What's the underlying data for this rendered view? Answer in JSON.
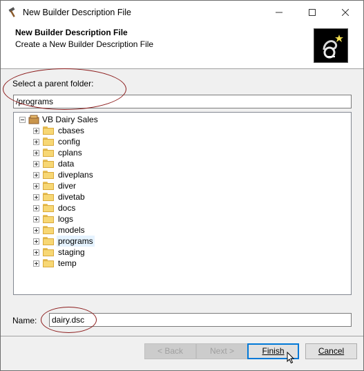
{
  "window": {
    "title": "New Builder Description File",
    "controls": {
      "minimize": "—",
      "maximize": "☐",
      "close": "✕"
    }
  },
  "banner": {
    "title": "New Builder Description File",
    "subtitle": "Create a New Builder Description File"
  },
  "parent_folder": {
    "label": "Select a parent folder:",
    "value": "/programs"
  },
  "tree": {
    "root": "VB Dairy Sales",
    "items": [
      {
        "label": "cbases"
      },
      {
        "label": "config"
      },
      {
        "label": "cplans"
      },
      {
        "label": "data"
      },
      {
        "label": "diveplans"
      },
      {
        "label": "diver"
      },
      {
        "label": "divetab"
      },
      {
        "label": "docs"
      },
      {
        "label": "logs"
      },
      {
        "label": "models"
      },
      {
        "label": "programs",
        "selected": true
      },
      {
        "label": "staging"
      },
      {
        "label": "temp"
      }
    ]
  },
  "name_field": {
    "label": "Name:",
    "value": "dairy.dsc"
  },
  "buttons": {
    "back": "< Back",
    "next": "Next >",
    "finish": "Finish",
    "cancel": "Cancel"
  },
  "colors": {
    "annotation": "#8b1a1a",
    "selection": "#e5f3ff",
    "default_button_border": "#0078d7"
  }
}
